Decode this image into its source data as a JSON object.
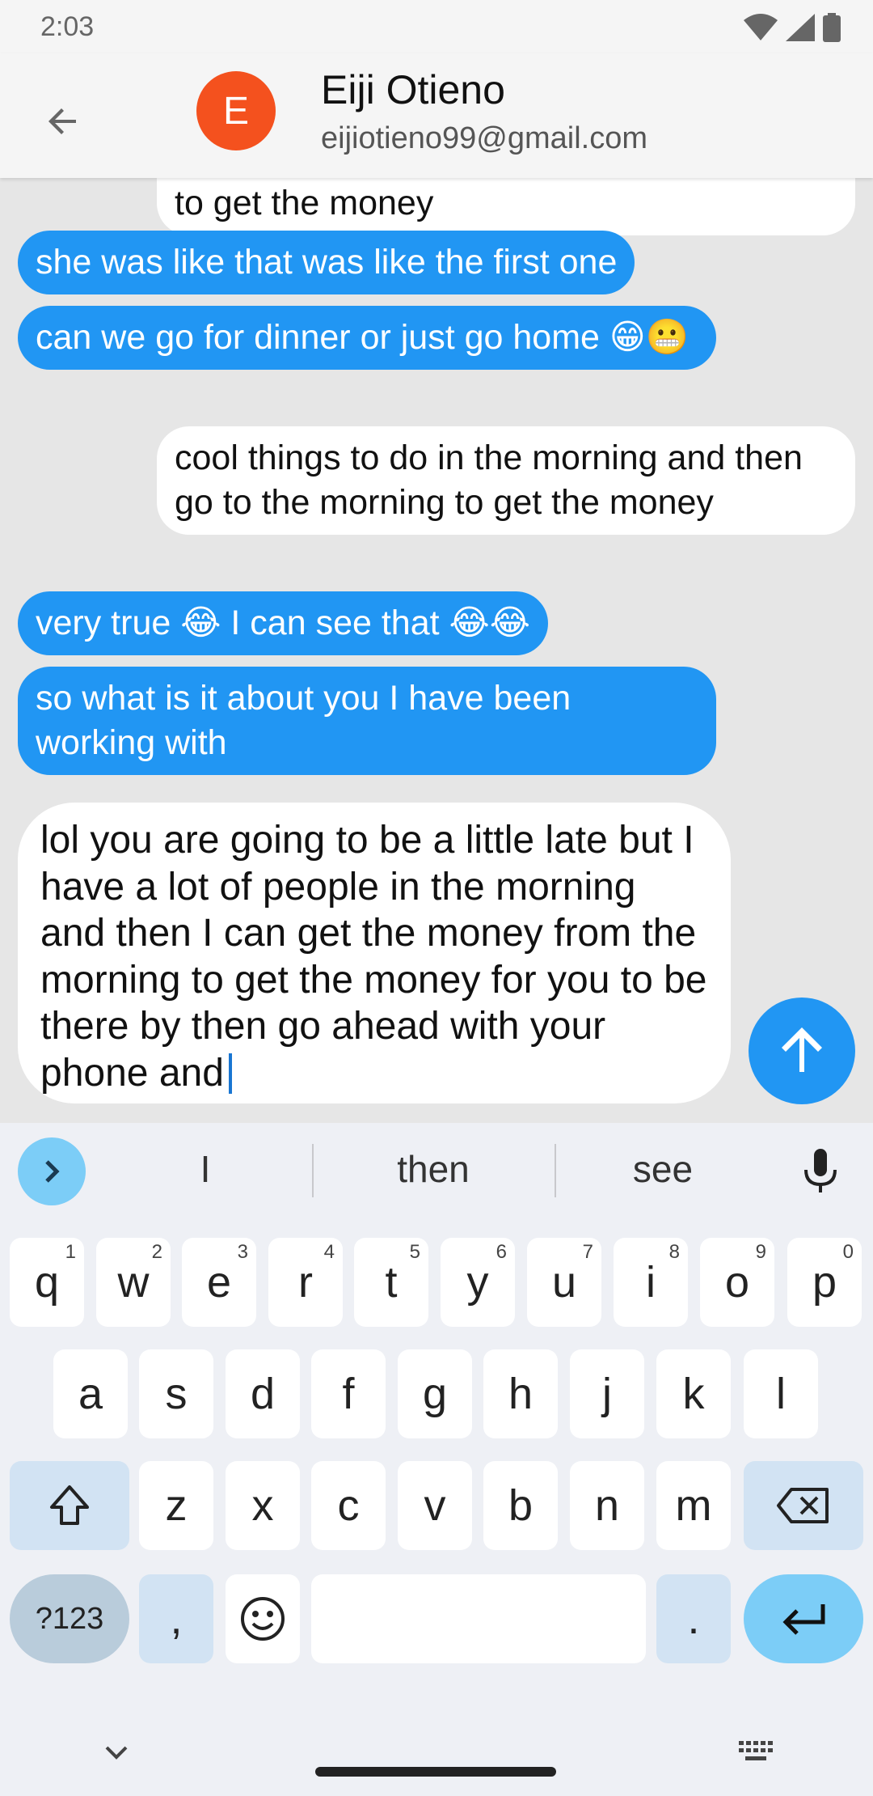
{
  "status_bar": {
    "time": "2:03"
  },
  "header": {
    "avatar_letter": "E",
    "contact_name": "Eiji Otieno",
    "contact_email": "eijiotieno99@gmail.com",
    "avatar_color": "#f4511e"
  },
  "messages": [
    {
      "direction": "out",
      "text": "to get the money"
    },
    {
      "direction": "in",
      "text": "she was like that was like the first one"
    },
    {
      "direction": "in",
      "text": "can we go for dinner or just go home 😁😬"
    },
    {
      "direction": "out",
      "text": "cool things to do in the morning and then go to the morning to get the money"
    },
    {
      "direction": "in",
      "text": "very true 😂 I can see that 😂😂"
    },
    {
      "direction": "in",
      "text": "so what is it about you I have been working with"
    }
  ],
  "composer": {
    "text": "lol you are going to be a little late but I have a lot of people in the morning and then I can get the money from the morning to get the money for you to be there by then go ahead with your phone and"
  },
  "keyboard": {
    "suggestions": [
      "I",
      "then",
      "see"
    ],
    "row1": [
      {
        "key": "q",
        "hint": "1"
      },
      {
        "key": "w",
        "hint": "2"
      },
      {
        "key": "e",
        "hint": "3"
      },
      {
        "key": "r",
        "hint": "4"
      },
      {
        "key": "t",
        "hint": "5"
      },
      {
        "key": "y",
        "hint": "6"
      },
      {
        "key": "u",
        "hint": "7"
      },
      {
        "key": "i",
        "hint": "8"
      },
      {
        "key": "o",
        "hint": "9"
      },
      {
        "key": "p",
        "hint": "0"
      }
    ],
    "row2": [
      "a",
      "s",
      "d",
      "f",
      "g",
      "h",
      "j",
      "k",
      "l"
    ],
    "row3": [
      "z",
      "x",
      "c",
      "v",
      "b",
      "n",
      "m"
    ],
    "symbols_label": "?123",
    "comma": ",",
    "period": "."
  },
  "colors": {
    "incoming_bubble": "#2196f3",
    "outgoing_bubble": "#ffffff",
    "chat_background": "#e6e6e6",
    "send_button": "#2196f3",
    "keyboard_accent": "#7ccdf7"
  }
}
